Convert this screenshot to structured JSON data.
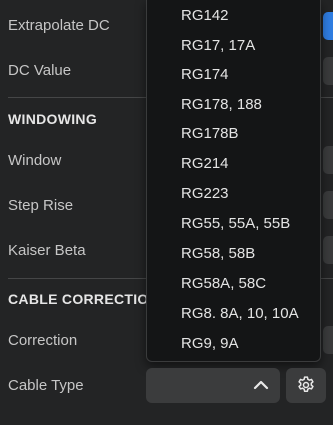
{
  "rows": {
    "extrapolate_dc": "Extrapolate DC",
    "dc_value": "DC Value",
    "window": "Window",
    "step_rise": "Step Rise",
    "kaiser_beta": "Kaiser Beta",
    "correction": "Correction",
    "cable_type": "Cable Type"
  },
  "sections": {
    "windowing": "WINDOWING",
    "cable_correction": "CABLE CORRECTIO"
  },
  "dropdown": {
    "options": [
      "RG142",
      "RG17, 17A",
      "RG174",
      "RG178, 188",
      "RG178B",
      "RG214",
      "RG223",
      "RG55, 55A, 55B",
      "RG58, 58B",
      "RG58A, 58C",
      "RG8. 8A, 10, 10A",
      "RG9, 9A"
    ]
  },
  "icons": {
    "chevron": "chevron-up-icon",
    "settings": "gear-icon"
  },
  "colors": {
    "background": "#232425",
    "accent": "#2f7de1",
    "dropdown_bg": "#141516",
    "control_bg": "#3b3c3d"
  }
}
